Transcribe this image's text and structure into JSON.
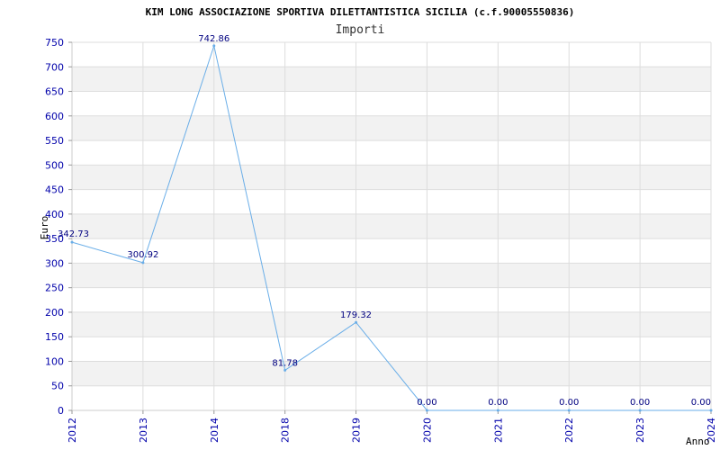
{
  "chart_data": {
    "type": "line",
    "title": "KIM LONG ASSOCIAZIONE SPORTIVA DILETTANTISTICA SICILIA (c.f.90005550836)",
    "subtitle": "Importi",
    "xlabel": "Anno",
    "ylabel": "Euro",
    "categories": [
      "2012",
      "2013",
      "2014",
      "2018",
      "2019",
      "2020",
      "2021",
      "2022",
      "2023",
      "2024"
    ],
    "values": [
      342.73,
      300.92,
      742.86,
      81.78,
      179.32,
      0,
      0,
      0,
      0,
      0
    ],
    "data_labels": [
      "342.73",
      "300.92",
      "742.86",
      "81.78",
      "179.32",
      "0.00",
      "0.00",
      "0.00",
      "0.00",
      "0.00"
    ],
    "ylim": [
      0,
      750
    ],
    "yticks": [
      0,
      50,
      100,
      150,
      200,
      250,
      300,
      350,
      400,
      450,
      500,
      550,
      600,
      650,
      700,
      750
    ],
    "grid": true,
    "colors": {
      "line": "#6aaee8",
      "band": "#f2f2f2",
      "grid": "#dddddd",
      "tick_text": "#0000aa",
      "label_text": "#000080"
    }
  }
}
